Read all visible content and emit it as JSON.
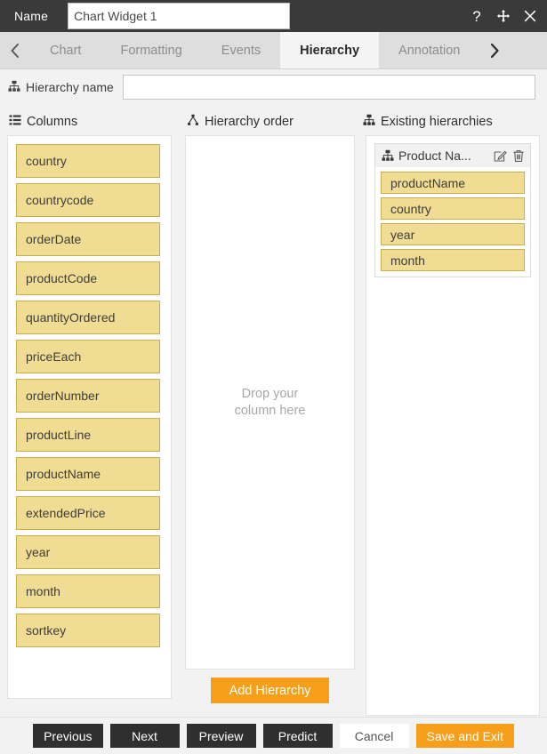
{
  "titlebar": {
    "name_label": "Name",
    "widget_name_value": "Chart Widget 1",
    "widget_name_placeholder": "",
    "help_icon": "question-mark-icon",
    "move_icon": "move-arrows-icon",
    "close_icon": "close-x-icon"
  },
  "tabs": {
    "prev_arrow": "chevron-left-icon",
    "next_arrow": "chevron-right-icon",
    "items": [
      {
        "label": "Chart",
        "active": false
      },
      {
        "label": "Formatting",
        "active": false
      },
      {
        "label": "Events",
        "active": false
      },
      {
        "label": "Hierarchy",
        "active": true
      },
      {
        "label": "Annotation",
        "active": false
      }
    ]
  },
  "hierarchy_name": {
    "label": "Hierarchy name",
    "icon": "hierarchy-icon",
    "value": "",
    "placeholder": ""
  },
  "columns_panel": {
    "header": "Columns",
    "header_icon": "list-icon",
    "items": [
      "country",
      "countrycode",
      "orderDate",
      "productCode",
      "quantityOrdered",
      "priceEach",
      "orderNumber",
      "productLine",
      "productName",
      "extendedPrice",
      "year",
      "month",
      "sortkey"
    ]
  },
  "order_panel": {
    "header": "Hierarchy order",
    "header_icon": "hierarchy-order-icon",
    "dropzone_line1": "Drop your",
    "dropzone_line2": "column here",
    "add_button": "Add Hierarchy"
  },
  "existing_panel": {
    "header": "Existing hierarchies",
    "header_icon": "hierarchy-icon",
    "hierarchies": [
      {
        "title": "Product Na...",
        "icon": "hierarchy-icon",
        "edit_icon": "edit-pencil-icon",
        "delete_icon": "trash-icon",
        "levels": [
          "productName",
          "country",
          "year",
          "month"
        ]
      }
    ]
  },
  "footer": {
    "buttons": [
      {
        "label": "Previous",
        "style": "dark"
      },
      {
        "label": "Next",
        "style": "dark"
      },
      {
        "label": "Preview",
        "style": "dark"
      },
      {
        "label": "Predict",
        "style": "dark"
      },
      {
        "label": "Cancel",
        "style": "light"
      },
      {
        "label": "Save and Exit",
        "style": "orange"
      }
    ]
  },
  "colors": {
    "titlebar_bg": "#3a3a3a",
    "tabbar_bg": "#dedede",
    "active_tab_bg": "#f4f4f4",
    "tile_bg": "#f0dd93",
    "tile_border": "#c9ae4e",
    "accent_orange": "#f79f1a",
    "page_bg": "#f2f2f2"
  }
}
